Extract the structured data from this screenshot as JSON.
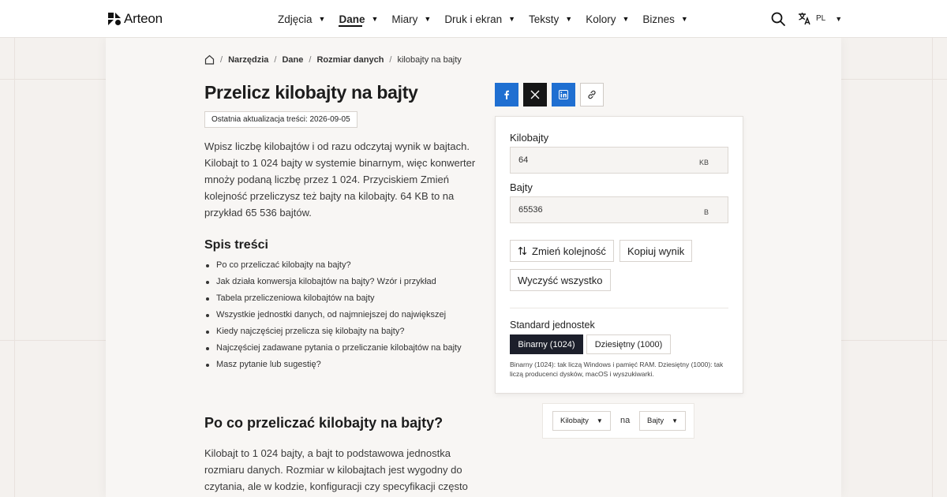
{
  "brand": {
    "name": "Arteon"
  },
  "nav": {
    "items": [
      {
        "label": "Zdjęcia",
        "active": false
      },
      {
        "label": "Dane",
        "active": true
      },
      {
        "label": "Miary",
        "active": false
      },
      {
        "label": "Druk i ekran",
        "active": false
      },
      {
        "label": "Teksty",
        "active": false
      },
      {
        "label": "Kolory",
        "active": false
      },
      {
        "label": "Biznes",
        "active": false
      }
    ],
    "caret": "▼",
    "language": "PL"
  },
  "breadcrumb": {
    "items": [
      "Narzędzia",
      "Dane",
      "Rozmiar danych"
    ],
    "current": "kilobajty na bajty",
    "separator": "/"
  },
  "article": {
    "title": "Przelicz kilobajty na bajty",
    "updated": "Ostatnia aktualizacja treści: 2026-09-05",
    "intro": "Wpisz liczbę kilobajtów i od razu odczytaj wynik w bajtach. Kilobajt to 1 024 bajty w systemie binarnym, więc konwerter mnoży podaną liczbę przez 1 024. Przyciskiem Zmień kolejność przeliczysz też bajty na kilobajty. 64 KB to na przykład 65 536 bajtów.",
    "toc_title": "Spis treści",
    "toc": [
      "Po co przeliczać kilobajty na bajty?",
      "Jak działa konwersja kilobajtów na bajty? Wzór i przykład",
      "Tabela przeliczeniowa kilobajtów na bajty",
      "Wszystkie jednostki danych, od najmniejszej do największej",
      "Kiedy najczęściej przelicza się kilobajty na bajty?",
      "Najczęściej zadawane pytania o przeliczanie kilobajtów na bajty",
      "Masz pytanie lub sugestię?"
    ],
    "section_title": "Po co przeliczać kilobajty na bajty?",
    "section_text": "Kilobajt to 1 024 bajty, a bajt to podstawowa jednostka rozmiaru danych. Rozmiar w kilobajtach jest wygodny do czytania, ale w kodzie, konfiguracji czy specyfikacji często"
  },
  "converter": {
    "from_label": "Kilobajty",
    "from_value": "64",
    "from_unit": "KB",
    "to_label": "Bajty",
    "to_value": "65536",
    "to_unit": "B",
    "swap_label": "Zmień kolejność",
    "copy_label": "Kopiuj wynik",
    "clear_label": "Wyczyść wszystko",
    "standard_label": "Standard jednostek",
    "standard_binary": "Binarny (1024)",
    "standard_decimal": "Dziesiętny (1000)",
    "standard_selected": "binary",
    "standard_note": "Binarny (1024): tak liczą Windows i pamięć RAM. Dziesiętny (1000): tak liczą producenci dysków, macOS i wyszukiwarki."
  },
  "unit_switcher": {
    "from": "Kilobajty",
    "middle": "na",
    "to": "Bajty"
  },
  "colors": {
    "accent_dark": "#1c1f2b",
    "facebook": "#1f6fd1",
    "linkedin": "#1f6fd1",
    "x": "#161616"
  },
  "icons": [
    "home-icon",
    "search-icon",
    "translate-icon",
    "facebook-icon",
    "x-icon",
    "linkedin-icon",
    "link-icon",
    "swap-icon"
  ]
}
